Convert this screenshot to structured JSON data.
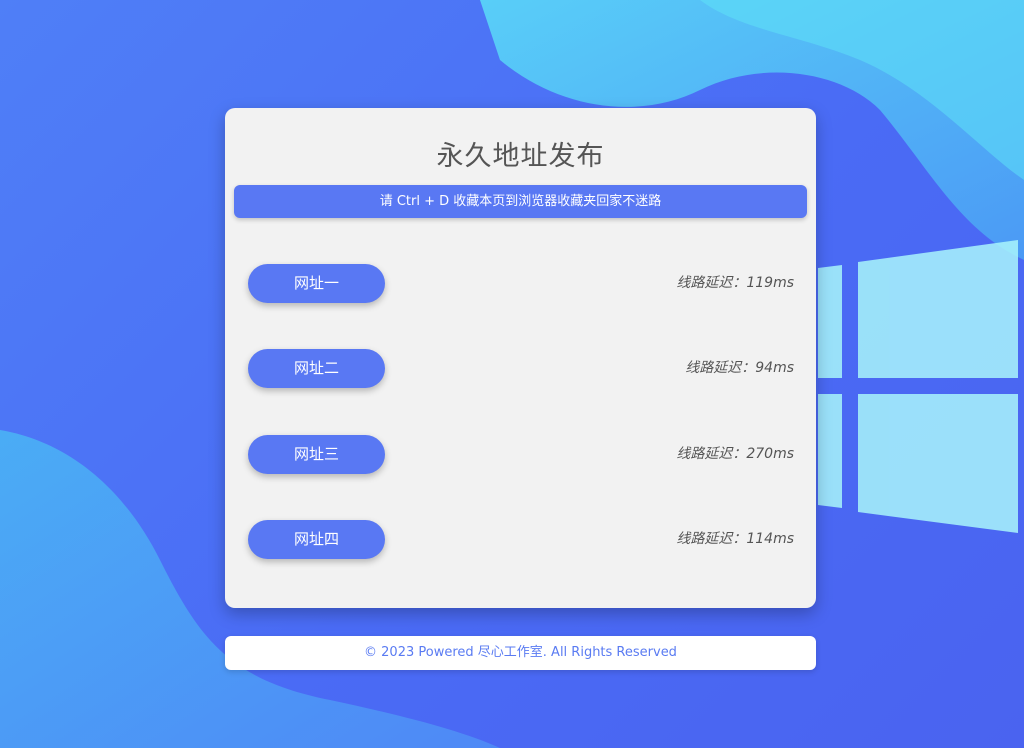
{
  "title": "永久地址发布",
  "notice": "请 Ctrl + D 收藏本页到浏览器收藏夹回家不迷路",
  "links": [
    {
      "label": "网址一",
      "latency": "线路延迟：119ms"
    },
    {
      "label": "网址二",
      "latency": "线路延迟：94ms"
    },
    {
      "label": "网址三",
      "latency": "线路延迟：270ms"
    },
    {
      "label": "网址四",
      "latency": "线路延迟：114ms"
    }
  ],
  "footer": "© 2023 Powered 尽心工作室. All Rights Reserved",
  "colors": {
    "accent": "#5978f3",
    "background": "#4a6bf5",
    "card": "#f2f2f2",
    "footer_text": "#5a7bf2"
  }
}
